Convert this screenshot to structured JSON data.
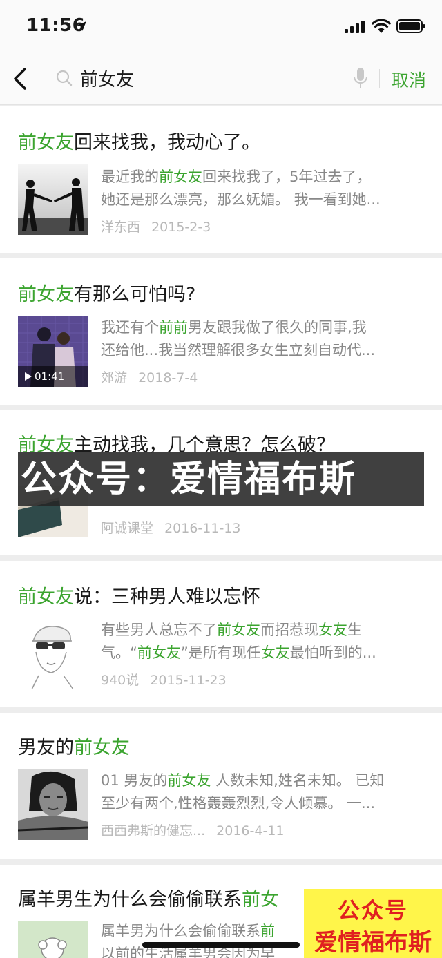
{
  "status_bar": {
    "time": "11:56"
  },
  "search": {
    "query": "前女友",
    "cancel_label": "取消"
  },
  "results": [
    {
      "title": [
        {
          "t": "前女友",
          "hl": true
        },
        {
          "t": "回来找我，我动心了。",
          "hl": false
        }
      ],
      "snippet_lines": [
        [
          {
            "t": "最近我的",
            "hl": false
          },
          {
            "t": "前女友",
            "hl": true
          },
          {
            "t": "回来找我了，5年过去了，",
            "hl": false
          }
        ],
        [
          {
            "t": "她还是那么漂亮，那么妩媚。 我一看到她...",
            "hl": false
          }
        ]
      ],
      "source": "洋东西",
      "date": "2015-2-3"
    },
    {
      "title": [
        {
          "t": "前女友",
          "hl": true
        },
        {
          "t": "有那么可怕吗?",
          "hl": false
        }
      ],
      "snippet_lines": [
        [
          {
            "t": "我还有个",
            "hl": false
          },
          {
            "t": "前前",
            "hl": true
          },
          {
            "t": "男友跟我做了很久的同事,我",
            "hl": false
          }
        ],
        [
          {
            "t": "还给他...我当然理解很多女生立刻自动代...",
            "hl": false
          }
        ]
      ],
      "source": "郊游",
      "date": "2018-7-4",
      "video_duration": "01:41"
    },
    {
      "title": [
        {
          "t": "前女友",
          "hl": true
        },
        {
          "t": "主动找我，几个意思？怎么破？",
          "hl": false
        }
      ],
      "snippet_lines": [],
      "source": "阿诚课堂",
      "date": "2016-11-13"
    },
    {
      "title": [
        {
          "t": "前女友",
          "hl": true
        },
        {
          "t": "说：三种男人难以忘怀",
          "hl": false
        }
      ],
      "snippet_lines": [
        [
          {
            "t": "有些男人总忘不了",
            "hl": false
          },
          {
            "t": "前女友",
            "hl": true
          },
          {
            "t": "而招惹现",
            "hl": false
          },
          {
            "t": "女友",
            "hl": true
          },
          {
            "t": "生",
            "hl": false
          }
        ],
        [
          {
            "t": "气。“",
            "hl": false
          },
          {
            "t": "前女友",
            "hl": true
          },
          {
            "t": "”是所有现任",
            "hl": false
          },
          {
            "t": "女友",
            "hl": true
          },
          {
            "t": "最怕听到的...",
            "hl": false
          }
        ]
      ],
      "source": "940说",
      "date": "2015-11-23"
    },
    {
      "title": [
        {
          "t": "男友的",
          "hl": false
        },
        {
          "t": "前女友",
          "hl": true
        }
      ],
      "snippet_lines": [
        [
          {
            "t": "01 男友的",
            "hl": false
          },
          {
            "t": "前女友",
            "hl": true
          },
          {
            "t": " 人数未知,姓名未知。 已知",
            "hl": false
          }
        ],
        [
          {
            "t": "至少有两个,性格轰轰烈烈,令人倾慕。 一...",
            "hl": false
          }
        ]
      ],
      "source": "西西弗斯的健忘...",
      "date": "2016-4-11"
    },
    {
      "title": [
        {
          "t": "属羊男生为什么会偷偷联系",
          "hl": false
        },
        {
          "t": "前女",
          "hl": true
        }
      ],
      "snippet_lines": [
        [
          {
            "t": "属羊男为什么会偷偷联系",
            "hl": false
          },
          {
            "t": "前",
            "hl": true
          }
        ],
        [
          {
            "t": "以前的生活属羊男会因为早",
            "hl": false
          }
        ]
      ]
    }
  ],
  "watermark": {
    "banner_text": "公众号：爱情福布斯",
    "corner_line1": "公众号",
    "corner_line2": "爱情福布斯"
  },
  "colors": {
    "accent_green": "#3ba42f",
    "snippet_gray": "#888888",
    "meta_gray": "#b8b8b8",
    "background": "#ededed"
  }
}
